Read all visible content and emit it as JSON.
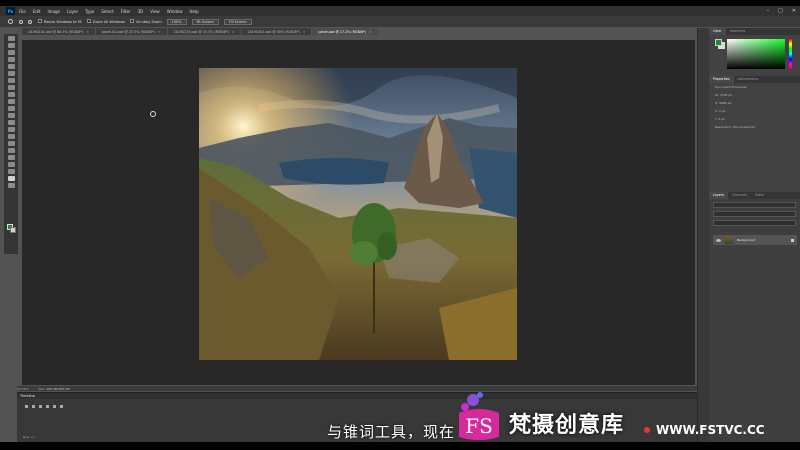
{
  "app": {
    "logo_text": "Ps",
    "menu": [
      "File",
      "Edit",
      "Image",
      "Layer",
      "Type",
      "Select",
      "Filter",
      "3D",
      "View",
      "Window",
      "Help"
    ],
    "window_controls": [
      "–",
      "□",
      "✕"
    ]
  },
  "options_bar": {
    "items": [
      "Resize Windows to Fit",
      "Zoom All Windows",
      "Scrubby Zoom"
    ],
    "zoom_value": "100%",
    "fit_screen": "Fit Screen",
    "fill_screen": "Fill Screen"
  },
  "tabs": [
    {
      "label": "20190101.psd @ 66.7% (RGB/8*)",
      "active": false
    },
    {
      "label": "panel-01.psd @ 25.5% (RGB/8*)",
      "active": false
    },
    {
      "label": "20190215.psd @ 33.3% (RGB/8*)",
      "active": false
    },
    {
      "label": "20190301.psd @ 50% (RGB/8*)",
      "active": false
    },
    {
      "label": "panel.psd @ 17.2% (RGB/8*)",
      "active": true
    }
  ],
  "status": {
    "zoom": "17.21%",
    "doc": "Doc: 286.0M/286.0M"
  },
  "timeline": {
    "title": "Timeline"
  },
  "panels": {
    "color_tabs": [
      "Color",
      "Swatches"
    ],
    "props_tabs": [
      "Properties",
      "Adjustments"
    ],
    "props_title": "Document Properties",
    "props_rows": [
      "W: 7500 px",
      "H: 6880 px",
      "X: 0 px",
      "Y: 0 px",
      "Resolution: 300 pixels/inch"
    ],
    "layers_tabs": [
      "Layers",
      "Channels",
      "Paths"
    ],
    "layer_name": "Background"
  },
  "overlay": {
    "subtitle": "与锥词工具，现在",
    "brand": "梵摄创意库",
    "url": "WWW.FSTVC.CC"
  },
  "colors": {
    "foreground": "#1e8b36",
    "background": "#dddddd",
    "brand_accent": "#c52fd1"
  }
}
